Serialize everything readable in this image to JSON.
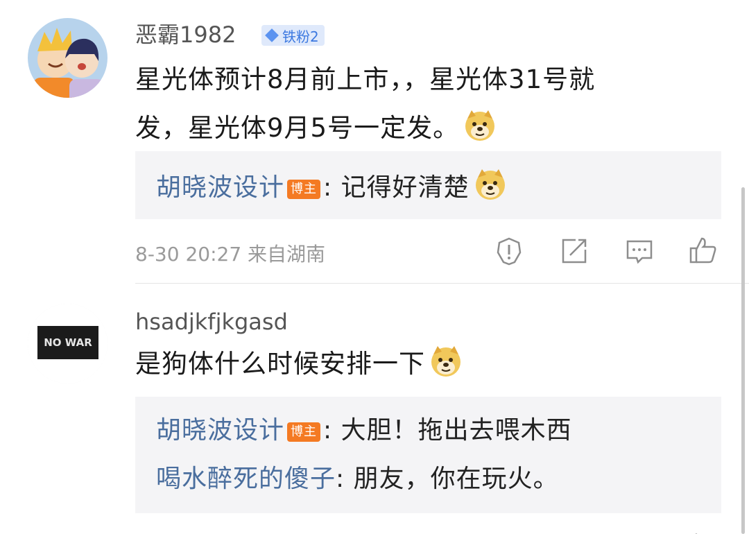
{
  "comments": [
    {
      "username": "恶霸1982",
      "fan_badge": "铁粉2",
      "text_line1": "星光体预计8月前上市，，星光体31号就",
      "text_line2": "发，星光体9月5号一定发。",
      "replies": [
        {
          "user": "胡晓波设计",
          "badge": "博主",
          "sep": ":",
          "text": "记得好清楚"
        }
      ],
      "meta": "8-30 20:27 来自湖南"
    },
    {
      "username": "hsadjkfjkgasd",
      "avatar_text": "NO WAR",
      "text_line1": "是狗体什么时候安排一下",
      "replies": [
        {
          "user": "胡晓波设计",
          "badge": "博主",
          "sep": ":",
          "text": "大胆！拖出去喂木西"
        },
        {
          "user": "喝水醉死的傻子",
          "badge": "",
          "sep": ":",
          "text": "朋友，你在玩火。"
        }
      ]
    }
  ],
  "icons": {
    "report": "report-icon",
    "repost": "repost-icon",
    "comment": "comment-icon",
    "like": "like-icon",
    "emoji": "doge-emoji-icon"
  },
  "colors": {
    "reply_user": "#4a6e9e",
    "author_badge": "#f47a23",
    "fan_badge_bg": "#dfe9fb",
    "fan_badge_text": "#3b78e0",
    "reply_bg": "#f4f4f6"
  }
}
